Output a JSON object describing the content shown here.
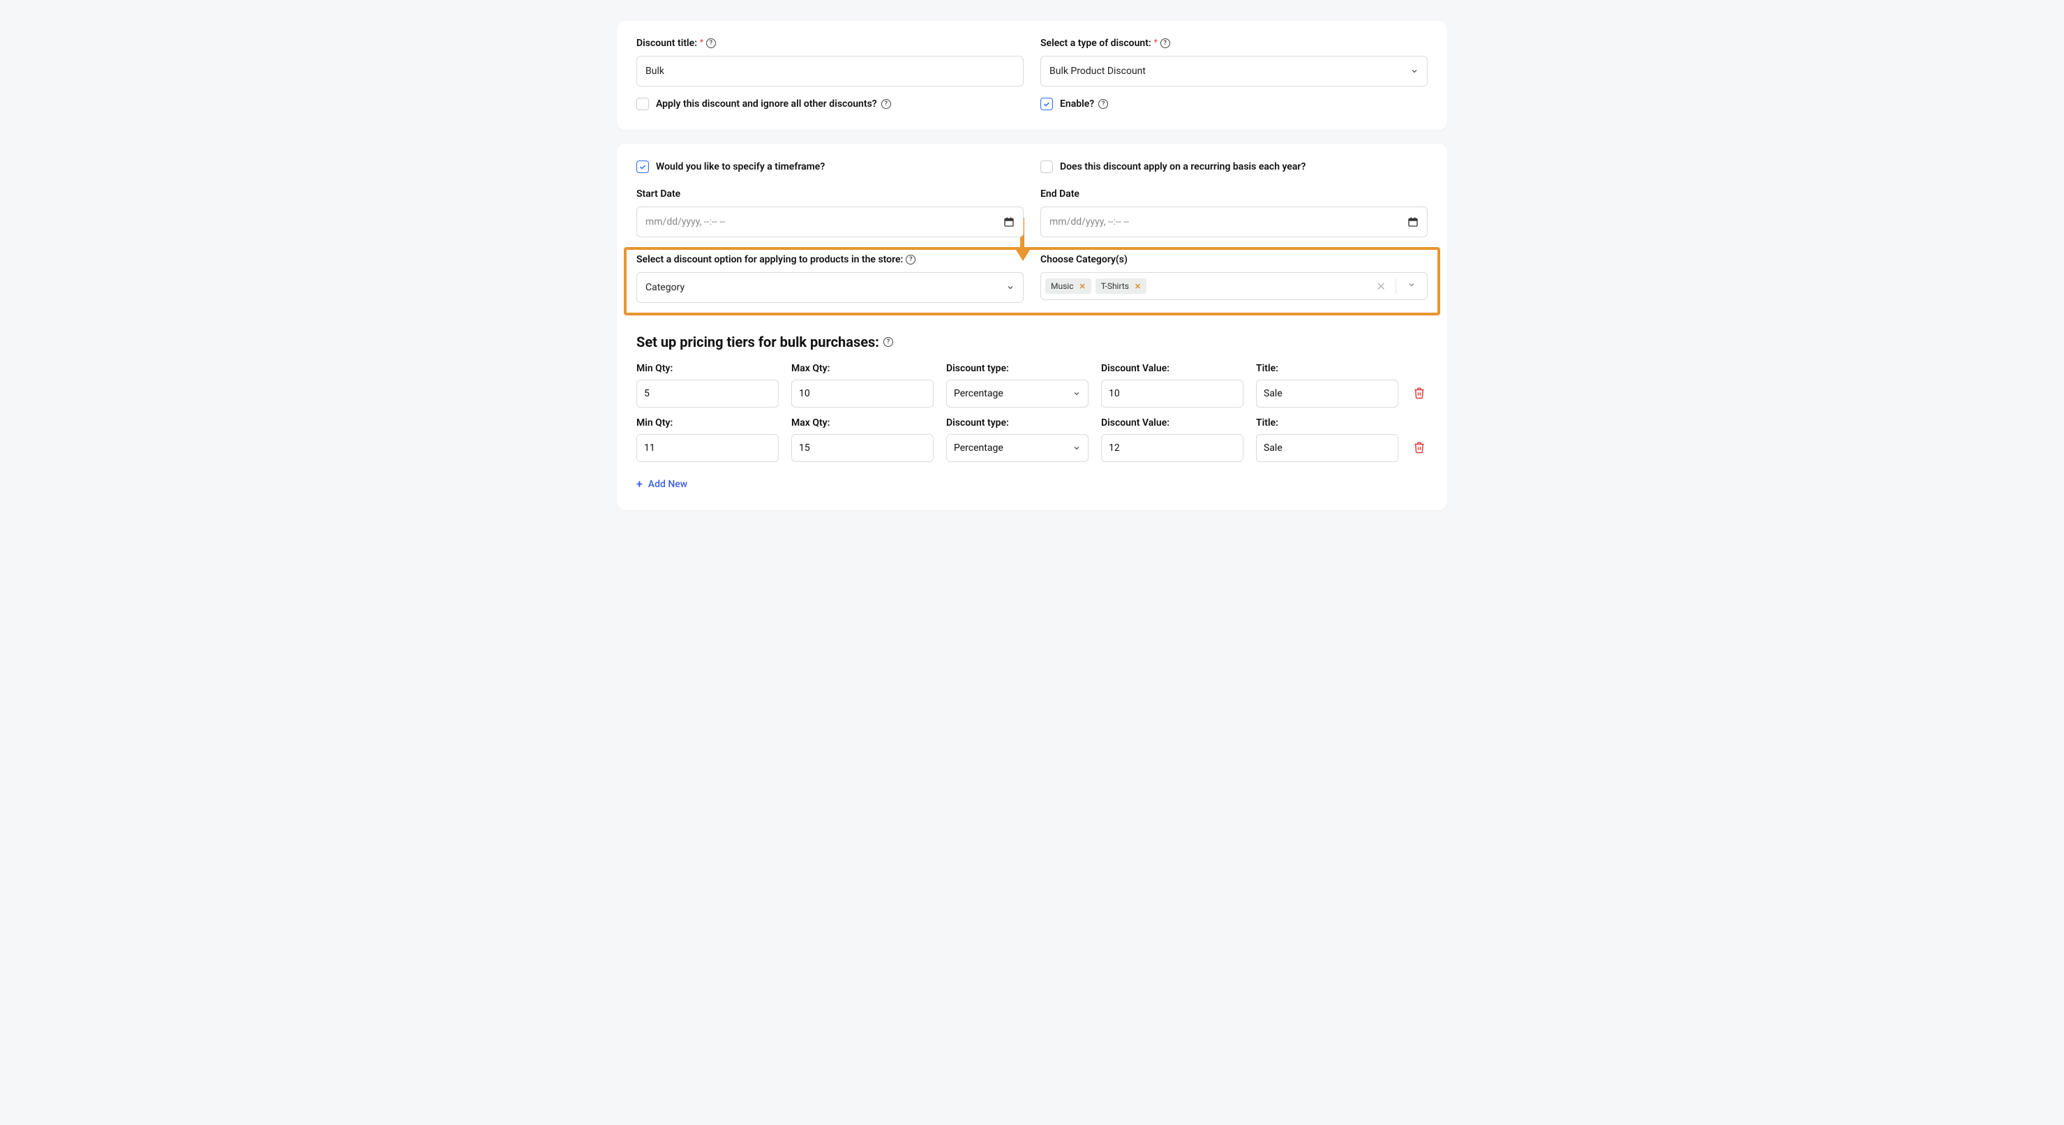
{
  "card1": {
    "title_label": "Discount title:",
    "title_value": "Bulk",
    "type_label": "Select a type of discount:",
    "type_value": "Bulk Product Discount",
    "ignore_label": "Apply this discount and ignore all other discounts?",
    "ignore_checked": false,
    "enable_label": "Enable?",
    "enable_checked": true
  },
  "card2": {
    "timeframe_label": "Would you like to specify a timeframe?",
    "timeframe_checked": true,
    "recurring_label": "Does this discount apply on a recurring basis each year?",
    "recurring_checked": false,
    "start_label": "Start Date",
    "start_placeholder": "mm/dd/yyyy, --:-- --",
    "end_label": "End Date",
    "end_placeholder": "mm/dd/yyyy, --:-- --",
    "option_label": "Select a discount option for applying to products in the store:",
    "option_value": "Category",
    "category_label": "Choose Category(s)",
    "categories": [
      {
        "name": "Music"
      },
      {
        "name": "T-Shirts"
      }
    ],
    "tiers_heading": "Set up pricing tiers for bulk purchases:",
    "col_min": "Min Qty:",
    "col_max": "Max Qty:",
    "col_type": "Discount type:",
    "col_value": "Discount Value:",
    "col_title": "Title:",
    "tiers": [
      {
        "min": "5",
        "max": "10",
        "type": "Percentage",
        "value": "10",
        "title": "Sale"
      },
      {
        "min": "11",
        "max": "15",
        "type": "Percentage",
        "value": "12",
        "title": "Sale"
      }
    ],
    "add_new": "Add New"
  }
}
